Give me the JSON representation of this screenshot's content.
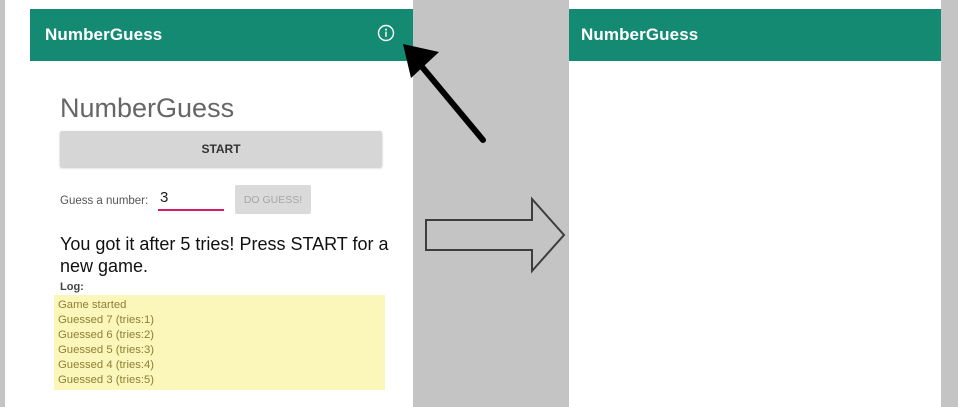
{
  "left_screen": {
    "appbar": {
      "title": "NumberGuess",
      "info_icon": "info-circle-icon"
    },
    "heading": "NumberGuess",
    "start_button_label": "START",
    "guess": {
      "label": "Guess a number:",
      "value": "3",
      "button_label": "DO GUESS!"
    },
    "result_message": "You got it after 5 tries! Press START for a new game.",
    "log": {
      "label": "Log:",
      "entries": [
        "Game started",
        "Guessed 7 (tries:1)",
        "Guessed 6 (tries:2)",
        "Guessed 5 (tries:3)",
        "Guessed 4 (tries:4)",
        "Guessed 3 (tries:5)"
      ]
    }
  },
  "right_screen": {
    "appbar": {
      "title": "NumberGuess"
    }
  },
  "annotations": {
    "pointer_arrow_icon": "arrow-up-left-icon",
    "transition_arrow_icon": "arrow-right-outline-icon"
  },
  "colors": {
    "appbar": "#148a73",
    "input_underline": "#d81b60",
    "log_background": "#fbf7ba",
    "log_text": "#8f7e35",
    "gutter": "#c4c4c4"
  }
}
